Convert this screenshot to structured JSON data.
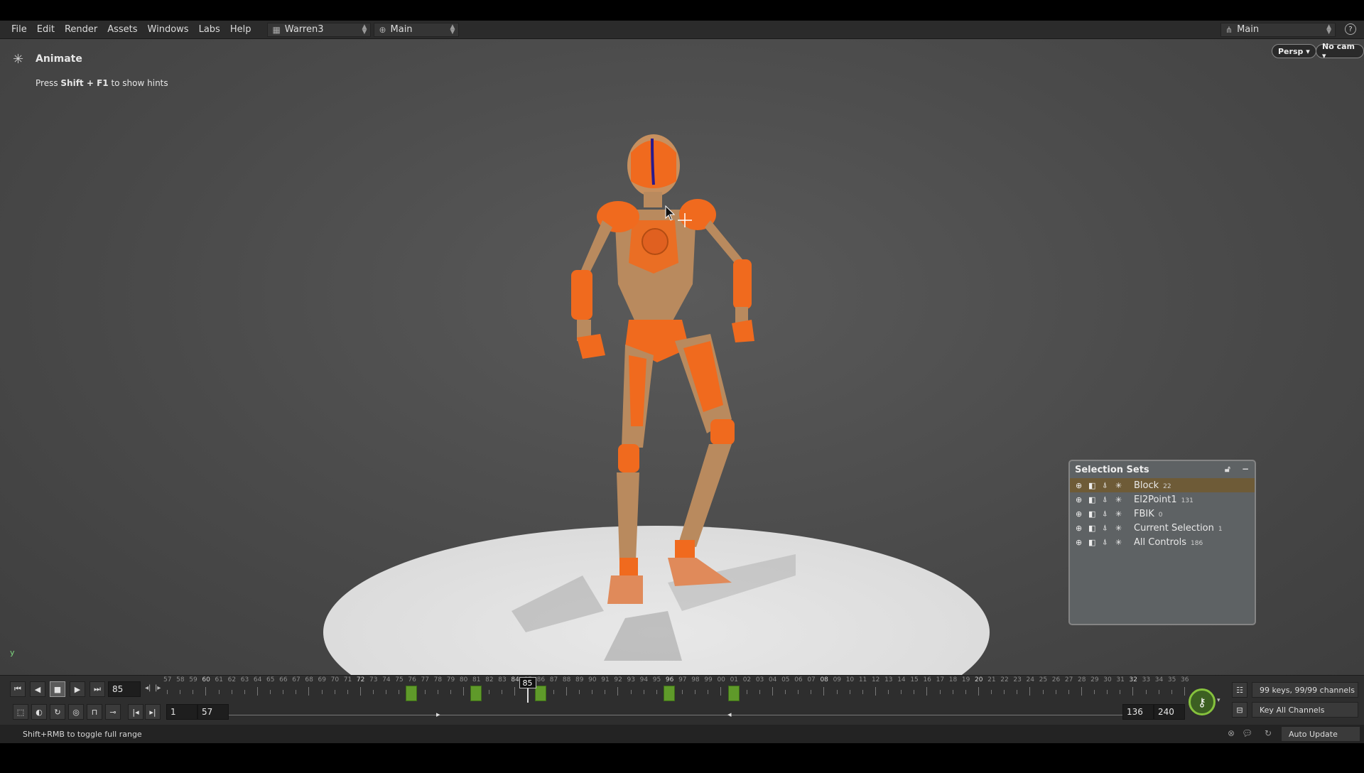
{
  "menu": [
    "File",
    "Edit",
    "Render",
    "Assets",
    "Windows",
    "Labs",
    "Help"
  ],
  "desktop": "Warren3",
  "context": "Main",
  "right_context": "Main",
  "help_icon": "question-icon",
  "viewport": {
    "mode_title": "Animate",
    "hint_pre": "Press ",
    "hint_keys": "Shift + F1",
    "hint_post": " to show hints",
    "persp": "Persp ▾",
    "cam": "No cam ▾",
    "axis_label": "y"
  },
  "selection_sets": {
    "title": "Selection Sets",
    "rows": [
      {
        "label": "Block",
        "count": "22",
        "active": true
      },
      {
        "label": "El2Point1",
        "count": "131",
        "active": false
      },
      {
        "label": "FBIK",
        "count": "0",
        "active": false
      },
      {
        "label": "Current Selection",
        "count": "1",
        "active": false
      },
      {
        "label": "All Controls",
        "count": "186",
        "active": false
      }
    ]
  },
  "timeline": {
    "current_frame": "85",
    "range_start": "1",
    "range_sub": "57",
    "range_end_a": "136",
    "range_end_b": "240",
    "ruler_start": 57,
    "ruler_end": 136,
    "keys": [
      76,
      81,
      86,
      96,
      101
    ],
    "keys_info": "99 keys, 99/99 channels",
    "key_mode": "Key All Channels",
    "update_mode": "Auto Update"
  },
  "status": {
    "message": "Shift+RMB to toggle full range"
  },
  "colors": {
    "key_green": "#5f9a2a",
    "active_row": "#6e5b37",
    "figure_orange": "#f06a1e",
    "figure_wood": "#b98a5e"
  }
}
